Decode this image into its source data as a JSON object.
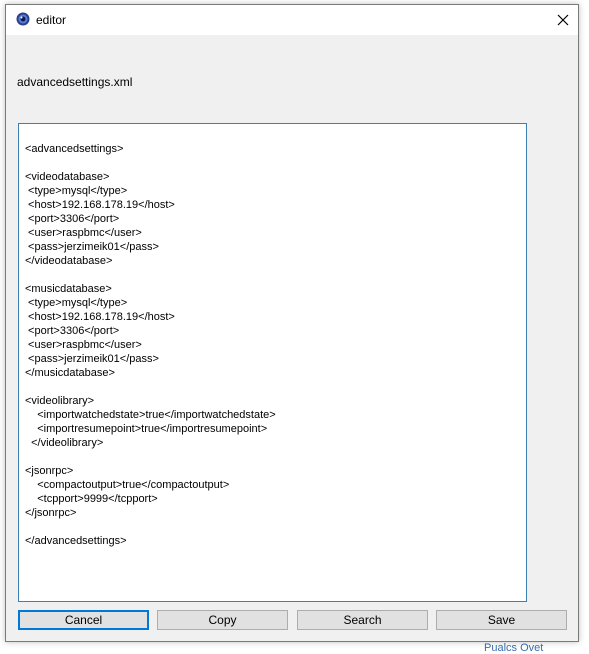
{
  "window": {
    "title": "editor",
    "filename": "advancedsettings.xml"
  },
  "background": {
    "fragment": "Pualcs Ovet"
  },
  "editor": {
    "content": "<advancedsettings>\n\n<videodatabase>\n <type>mysql</type>\n <host>192.168.178.19</host>\n <port>3306</port>\n <user>raspbmc</user>\n <pass>jerzimeik01</pass>\n</videodatabase>\n\n<musicdatabase>\n <type>mysql</type>\n <host>192.168.178.19</host>\n <port>3306</port>\n <user>raspbmc</user>\n <pass>jerzimeik01</pass>\n</musicdatabase>\n\n<videolibrary>\n    <importwatchedstate>true</importwatchedstate>\n    <importresumepoint>true</importresumepoint>\n  </videolibrary>\n\n<jsonrpc>\n    <compactoutput>true</compactoutput>\n    <tcpport>9999</tcpport>\n</jsonrpc>\n\n</advancedsettings>"
  },
  "buttons": {
    "cancel": "Cancel",
    "copy": "Copy",
    "search": "Search",
    "save": "Save"
  },
  "colors": {
    "accent": "#0078d7",
    "editor_border": "#3c7fb1",
    "dialog_bg": "#f0f0f0"
  }
}
